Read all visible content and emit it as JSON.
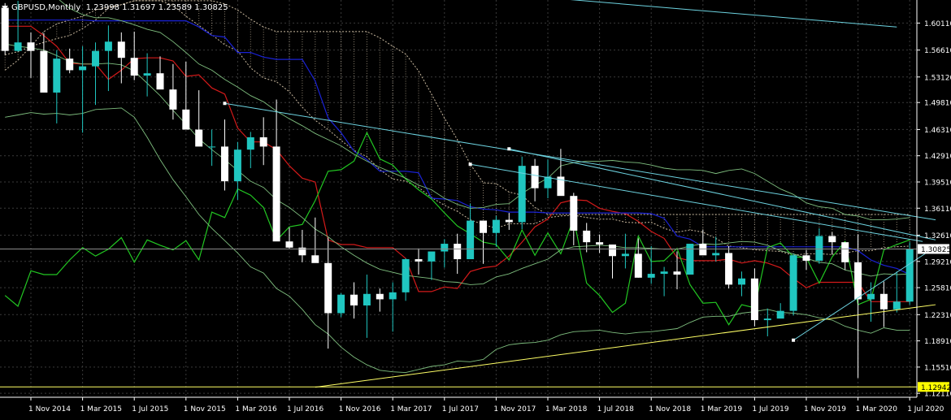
{
  "header": {
    "symbol": "GBPUSD",
    "timeframe": "Monthly",
    "open": "1.23998",
    "high": "1.31697",
    "low": "1.23589",
    "close": "1.30825"
  },
  "colors": {
    "background": "#000000",
    "grid": "#3a3a3a",
    "axis": "#ffffff",
    "bull_candle": "#20c6c0",
    "bear_candle": "#ffffff",
    "tenkan": "#d41a1a",
    "kijun": "#1a22d6",
    "chikou": "#22c722",
    "bollinger": "#7fbf7f",
    "senkou_cloud": "#c8b89e",
    "trendline_cyan": "#6dd3e0",
    "trendline_yellow": "#ffff66",
    "price_marker_bg": "#ffffff",
    "low_marker_bg": "#ffff00"
  },
  "y_axis": {
    "ticks": [
      "1.60110",
      "1.56610",
      "1.53120",
      "1.49810",
      "1.46310",
      "1.42910",
      "1.39510",
      "1.36110",
      "1.32610",
      "1.29210",
      "1.25810",
      "1.22310",
      "1.18910",
      "1.15510",
      "1.12110"
    ]
  },
  "x_axis": {
    "ticks": [
      "1 Nov 2014",
      "1 Mar 2015",
      "1 Jul 2015",
      "1 Nov 2015",
      "1 Mar 2016",
      "1 Jul 2016",
      "1 Nov 2016",
      "1 Mar 2017",
      "1 Jul 2017",
      "1 Nov 2017",
      "1 Mar 2018",
      "1 Jul 2018",
      "1 Nov 2018",
      "1 Mar 2019",
      "1 Jul 2019",
      "1 Nov 2019",
      "1 Mar 2020",
      "1 Jul 2020"
    ]
  },
  "markers": {
    "current_price": "1.30825",
    "level_price": "1.12942"
  },
  "chart_data": {
    "type": "candlestick",
    "title": "GBPUSD,Monthly",
    "ylim": [
      1.116,
      1.631
    ],
    "x": [
      "2014-09",
      "2014-10",
      "2014-11",
      "2014-12",
      "2015-01",
      "2015-02",
      "2015-03",
      "2015-04",
      "2015-05",
      "2015-06",
      "2015-07",
      "2015-08",
      "2015-09",
      "2015-10",
      "2015-11",
      "2015-12",
      "2016-01",
      "2016-02",
      "2016-03",
      "2016-04",
      "2016-05",
      "2016-06",
      "2016-07",
      "2016-08",
      "2016-09",
      "2016-10",
      "2016-11",
      "2016-12",
      "2017-01",
      "2017-02",
      "2017-03",
      "2017-04",
      "2017-05",
      "2017-06",
      "2017-07",
      "2017-08",
      "2017-09",
      "2017-10",
      "2017-11",
      "2017-12",
      "2018-01",
      "2018-02",
      "2018-03",
      "2018-04",
      "2018-05",
      "2018-06",
      "2018-07",
      "2018-08",
      "2018-09",
      "2018-10",
      "2018-11",
      "2018-12",
      "2019-01",
      "2019-02",
      "2019-03",
      "2019-04",
      "2019-05",
      "2019-06",
      "2019-07",
      "2019-08",
      "2019-09",
      "2019-10",
      "2019-11",
      "2019-12",
      "2020-01",
      "2020-02",
      "2020-03",
      "2020-04",
      "2020-05",
      "2020-06",
      "2020-07"
    ],
    "open": [
      1.621,
      1.565,
      1.576,
      1.565,
      1.511,
      1.555,
      1.54,
      1.545,
      1.565,
      1.577,
      1.556,
      1.533,
      1.536,
      1.515,
      1.489,
      1.463,
      1.441,
      1.441,
      1.396,
      1.437,
      1.453,
      1.441,
      1.318,
      1.31,
      1.3,
      1.29,
      1.225,
      1.249,
      1.235,
      1.25,
      1.243,
      1.252,
      1.295,
      1.292,
      1.305,
      1.315,
      1.295,
      1.345,
      1.329,
      1.346,
      1.343,
      1.416,
      1.387,
      1.402,
      1.377,
      1.332,
      1.317,
      1.314,
      1.299,
      1.302,
      1.271,
      1.276,
      1.279,
      1.275,
      1.315,
      1.3,
      1.303,
      1.262,
      1.27,
      1.216,
      1.218,
      1.228,
      1.3,
      1.293,
      1.325,
      1.317,
      1.291,
      1.243,
      1.25,
      1.23,
      1.24
    ],
    "high": [
      1.627,
      1.63,
      1.589,
      1.588,
      1.566,
      1.568,
      1.571,
      1.576,
      1.598,
      1.589,
      1.59,
      1.562,
      1.558,
      1.548,
      1.551,
      1.514,
      1.463,
      1.476,
      1.447,
      1.46,
      1.479,
      1.502,
      1.336,
      1.333,
      1.349,
      1.323,
      1.251,
      1.265,
      1.275,
      1.257,
      1.265,
      1.296,
      1.309,
      1.301,
      1.321,
      1.328,
      1.367,
      1.345,
      1.351,
      1.355,
      1.428,
      1.425,
      1.424,
      1.438,
      1.381,
      1.342,
      1.327,
      1.311,
      1.328,
      1.322,
      1.312,
      1.285,
      1.305,
      1.312,
      1.333,
      1.324,
      1.312,
      1.279,
      1.283,
      1.231,
      1.238,
      1.302,
      1.307,
      1.335,
      1.33,
      1.316,
      1.327,
      1.265,
      1.266,
      1.279,
      1.317
    ],
    "low": [
      1.56,
      1.564,
      1.53,
      1.553,
      1.471,
      1.536,
      1.459,
      1.495,
      1.513,
      1.523,
      1.527,
      1.506,
      1.519,
      1.476,
      1.484,
      1.461,
      1.416,
      1.384,
      1.372,
      1.413,
      1.417,
      1.319,
      1.309,
      1.291,
      1.292,
      1.179,
      1.22,
      1.218,
      1.193,
      1.227,
      1.201,
      1.241,
      1.275,
      1.268,
      1.284,
      1.276,
      1.306,
      1.289,
      1.311,
      1.333,
      1.334,
      1.37,
      1.374,
      1.401,
      1.313,
      1.304,
      1.303,
      1.27,
      1.283,
      1.271,
      1.263,
      1.247,
      1.256,
      1.283,
      1.302,
      1.292,
      1.257,
      1.247,
      1.208,
      1.195,
      1.221,
      1.222,
      1.281,
      1.289,
      1.301,
      1.281,
      1.141,
      1.214,
      1.207,
      1.226,
      1.236
    ],
    "close": [
      1.565,
      1.576,
      1.565,
      1.511,
      1.555,
      1.54,
      1.545,
      1.565,
      1.577,
      1.556,
      1.533,
      1.536,
      1.515,
      1.489,
      1.463,
      1.441,
      1.441,
      1.396,
      1.437,
      1.453,
      1.441,
      1.318,
      1.31,
      1.3,
      1.29,
      1.225,
      1.249,
      1.235,
      1.25,
      1.243,
      1.252,
      1.295,
      1.292,
      1.305,
      1.315,
      1.295,
      1.345,
      1.329,
      1.346,
      1.343,
      1.416,
      1.387,
      1.402,
      1.377,
      1.332,
      1.317,
      1.314,
      1.299,
      1.302,
      1.271,
      1.276,
      1.279,
      1.275,
      1.315,
      1.3,
      1.303,
      1.262,
      1.27,
      1.216,
      1.218,
      1.228,
      1.3,
      1.293,
      1.325,
      1.317,
      1.291,
      1.243,
      1.25,
      1.23,
      1.24,
      1.308
    ],
    "series": [
      {
        "role": "tenkan",
        "values": [
          1.597,
          1.597,
          1.597,
          1.585,
          1.571,
          1.549,
          1.548,
          1.548,
          1.528,
          1.54,
          1.555,
          1.556,
          1.556,
          1.552,
          1.532,
          1.534,
          1.517,
          1.509,
          1.465,
          1.447,
          1.447,
          1.437,
          1.416,
          1.4,
          1.395,
          1.32,
          1.314,
          1.314,
          1.31,
          1.31,
          1.31,
          1.296,
          1.253,
          1.253,
          1.259,
          1.257,
          1.279,
          1.284,
          1.286,
          1.299,
          1.317,
          1.337,
          1.347,
          1.368,
          1.372,
          1.371,
          1.361,
          1.357,
          1.354,
          1.344,
          1.331,
          1.322,
          1.297,
          1.293,
          1.293,
          1.293,
          1.295,
          1.29,
          1.293,
          1.29,
          1.284,
          1.27,
          1.258,
          1.265,
          1.265,
          1.265,
          1.265,
          1.24,
          1.24,
          1.24,
          1.24
        ]
      },
      {
        "role": "kijun",
        "values": [
          1.605,
          1.605,
          1.605,
          1.605,
          1.605,
          1.605,
          1.605,
          1.604,
          1.604,
          1.604,
          1.604,
          1.604,
          1.604,
          1.604,
          1.604,
          1.596,
          1.585,
          1.583,
          1.563,
          1.563,
          1.557,
          1.554,
          1.554,
          1.554,
          1.526,
          1.478,
          1.459,
          1.435,
          1.424,
          1.409,
          1.409,
          1.409,
          1.407,
          1.374,
          1.373,
          1.371,
          1.363,
          1.36,
          1.359,
          1.356,
          1.356,
          1.356,
          1.355,
          1.355,
          1.355,
          1.355,
          1.355,
          1.355,
          1.355,
          1.355,
          1.354,
          1.348,
          1.325,
          1.321,
          1.311,
          1.311,
          1.311,
          1.311,
          1.311,
          1.311,
          1.311,
          1.311,
          1.311,
          1.311,
          1.311,
          1.311,
          1.306,
          1.294,
          1.287,
          1.283,
          1.275
        ]
      },
      {
        "role": "chikou",
        "values": [
          1.248,
          1.234,
          1.28,
          1.275,
          1.275,
          1.294,
          1.31,
          1.299,
          1.308,
          1.323,
          1.291,
          1.32,
          1.313,
          1.307,
          1.319,
          1.294,
          1.356,
          1.349,
          1.386,
          1.378,
          1.362,
          1.319,
          1.337,
          1.34,
          1.371,
          1.409,
          1.411,
          1.422,
          1.459,
          1.425,
          1.417,
          1.399,
          1.385,
          1.373,
          1.355,
          1.338,
          1.328,
          1.317,
          1.314,
          1.294,
          1.333,
          1.3,
          1.329,
          1.302,
          1.348,
          1.264,
          1.248,
          1.226,
          1.238,
          1.325,
          1.292,
          1.293,
          1.309,
          1.262,
          1.238,
          1.239,
          1.21,
          1.236,
          1.232,
          1.31,
          1.316,
          1.298,
          1.297,
          1.264,
          1.298,
          1.318,
          1.236,
          1.243,
          1.307,
          1.314,
          1.32
        ]
      },
      {
        "role": "bollinger_upper",
        "values": [
          1.67,
          1.66,
          1.653,
          1.648,
          1.634,
          1.62,
          1.612,
          1.608,
          1.608,
          1.604,
          1.599,
          1.593,
          1.589,
          1.577,
          1.563,
          1.548,
          1.54,
          1.528,
          1.518,
          1.507,
          1.499,
          1.487,
          1.477,
          1.468,
          1.458,
          1.45,
          1.442,
          1.431,
          1.422,
          1.414,
          1.407,
          1.4,
          1.391,
          1.385,
          1.374,
          1.366,
          1.361,
          1.362,
          1.366,
          1.367,
          1.38,
          1.391,
          1.4,
          1.416,
          1.42,
          1.422,
          1.422,
          1.423,
          1.421,
          1.42,
          1.417,
          1.413,
          1.411,
          1.411,
          1.41,
          1.406,
          1.41,
          1.412,
          1.406,
          1.396,
          1.386,
          1.379,
          1.368,
          1.363,
          1.361,
          1.353,
          1.351,
          1.346,
          1.346,
          1.347,
          1.349
        ]
      },
      {
        "role": "bollinger_lower",
        "values": [
          1.479,
          1.482,
          1.485,
          1.483,
          1.484,
          1.482,
          1.484,
          1.489,
          1.49,
          1.491,
          1.479,
          1.453,
          1.424,
          1.398,
          1.376,
          1.353,
          1.335,
          1.319,
          1.303,
          1.285,
          1.277,
          1.257,
          1.247,
          1.23,
          1.21,
          1.198,
          1.181,
          1.168,
          1.158,
          1.151,
          1.149,
          1.148,
          1.152,
          1.156,
          1.158,
          1.163,
          1.162,
          1.165,
          1.178,
          1.184,
          1.186,
          1.187,
          1.19,
          1.197,
          1.201,
          1.202,
          1.203,
          1.2,
          1.198,
          1.2,
          1.201,
          1.203,
          1.205,
          1.213,
          1.22,
          1.221,
          1.221,
          1.225,
          1.227,
          1.23,
          1.226,
          1.225,
          1.223,
          1.219,
          1.216,
          1.208,
          1.203,
          1.199,
          1.206,
          1.203,
          1.203
        ]
      },
      {
        "role": "bollinger_middle",
        "values": [
          1.574,
          1.571,
          1.569,
          1.566,
          1.559,
          1.551,
          1.548,
          1.548,
          1.549,
          1.547,
          1.539,
          1.523,
          1.507,
          1.488,
          1.47,
          1.451,
          1.437,
          1.424,
          1.41,
          1.396,
          1.388,
          1.372,
          1.362,
          1.349,
          1.334,
          1.324,
          1.311,
          1.3,
          1.29,
          1.282,
          1.278,
          1.274,
          1.272,
          1.27,
          1.266,
          1.265,
          1.262,
          1.263,
          1.272,
          1.276,
          1.283,
          1.289,
          1.295,
          1.307,
          1.311,
          1.312,
          1.313,
          1.312,
          1.31,
          1.31,
          1.309,
          1.308,
          1.308,
          1.312,
          1.315,
          1.314,
          1.316,
          1.318,
          1.317,
          1.313,
          1.306,
          1.302,
          1.296,
          1.291,
          1.289,
          1.281,
          1.277,
          1.273,
          1.276,
          1.275,
          1.276
        ]
      }
    ],
    "cloud": {
      "span_a": [
        1.54,
        1.553,
        1.571,
        1.59,
        1.6,
        1.605,
        1.61,
        1.618,
        1.622,
        1.625,
        1.63,
        1.63,
        1.63,
        1.624,
        1.61,
        1.598,
        1.586,
        1.573,
        1.565,
        1.543,
        1.53,
        1.525,
        1.512,
        1.492,
        1.475,
        1.463,
        1.449,
        1.436,
        1.428,
        1.411,
        1.399,
        1.396,
        1.388,
        1.375,
        1.365,
        1.357,
        1.346,
        1.34,
        1.335,
        1.341,
        1.341,
        1.341,
        1.349,
        1.351,
        1.352,
        1.349,
        1.347,
        1.347,
        1.343,
        1.342,
        1.343,
        1.335,
        1.33,
        1.333,
        1.33,
        1.322,
        1.312,
        1.31,
        1.307,
        1.306,
        1.305,
        1.3,
        1.302,
        1.302,
        1.301,
        1.303,
        1.306,
        1.306,
        1.31,
        1.311,
        1.312
      ],
      "span_b": [
        1.56,
        1.564,
        1.571,
        1.576,
        1.581,
        1.585,
        1.594,
        1.605,
        1.62,
        1.625,
        1.63,
        1.63,
        1.63,
        1.63,
        1.63,
        1.63,
        1.63,
        1.626,
        1.618,
        1.606,
        1.596,
        1.59,
        1.59,
        1.59,
        1.59,
        1.59,
        1.59,
        1.59,
        1.59,
        1.582,
        1.571,
        1.561,
        1.539,
        1.509,
        1.478,
        1.45,
        1.418,
        1.394,
        1.393,
        1.382,
        1.378,
        1.362,
        1.353,
        1.353,
        1.353,
        1.353,
        1.353,
        1.353,
        1.353,
        1.353,
        1.353,
        1.353,
        1.353,
        1.353,
        1.353,
        1.353,
        1.353,
        1.353,
        1.353,
        1.353,
        1.353,
        1.353,
        1.353,
        1.353,
        1.353,
        1.353,
        1.353,
        1.353,
        1.353,
        1.353,
        1.353
      ]
    },
    "trendlines": [
      {
        "color": "cyan",
        "from": [
          "2016-02",
          1.497
        ],
        "to": [
          "2020-09",
          1.346
        ]
      },
      {
        "color": "cyan",
        "from": [
          "2017-12",
          1.438
        ],
        "to": [
          "2020-09",
          1.32
        ]
      },
      {
        "color": "cyan",
        "from": [
          "2017-09",
          1.418
        ],
        "to": [
          "2020-08",
          1.318
        ]
      },
      {
        "color": "cyan",
        "from": [
          "2014-09",
          1.693
        ],
        "to": [
          "2020-06",
          1.596
        ]
      },
      {
        "color": "yellow",
        "from": [
          "2016-09",
          1.129
        ],
        "to": [
          "2020-09",
          1.236
        ]
      },
      {
        "color": "cyan",
        "from": [
          "2019-10",
          1.19
        ],
        "to": [
          "2020-09",
          1.311
        ]
      }
    ],
    "horizontal_lines": [
      {
        "value": 1.12942,
        "color": "yellow"
      },
      {
        "value": 1.30825,
        "color": "grey"
      }
    ],
    "grid": true
  }
}
